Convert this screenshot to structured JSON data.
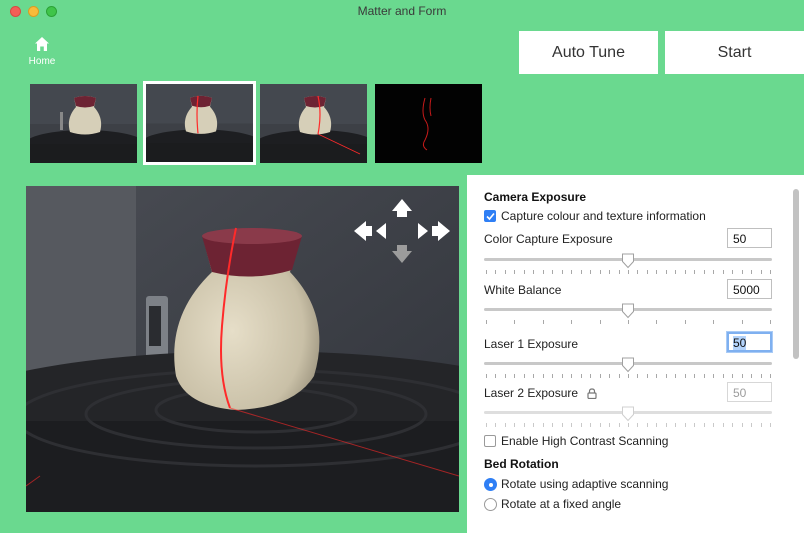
{
  "window": {
    "title": "Matter and Form"
  },
  "nav": {
    "home_label": "Home"
  },
  "toolbar": {
    "auto_tune_label": "Auto Tune",
    "start_label": "Start"
  },
  "thumbnails": {
    "count": 4,
    "selected_index": 1
  },
  "settings": {
    "camera_exposure": {
      "title": "Camera Exposure",
      "capture_colour_label": "Capture colour and texture information",
      "capture_colour_checked": true,
      "color_capture": {
        "label": "Color Capture Exposure",
        "value": "50",
        "level": 0.5
      },
      "white_balance": {
        "label": "White Balance",
        "value": "5000",
        "level": 0.5
      },
      "laser1": {
        "label": "Laser 1 Exposure",
        "value": "50",
        "level": 0.5,
        "focused": true
      },
      "laser2": {
        "label": "Laser 2 Exposure",
        "value": "50",
        "level": 0.5,
        "locked": true
      }
    },
    "high_contrast": {
      "label": "Enable High Contrast Scanning",
      "checked": false
    },
    "bed_rotation": {
      "title": "Bed Rotation",
      "options": [
        {
          "label": "Rotate using adaptive scanning",
          "selected": true
        },
        {
          "label": "Rotate at a fixed angle",
          "selected": false
        }
      ]
    }
  },
  "colors": {
    "window_bg": "#6ad98f",
    "accent": "#2f7ff5",
    "panel_bg": "#ffffff",
    "laser_red": "#ff2a2a"
  }
}
